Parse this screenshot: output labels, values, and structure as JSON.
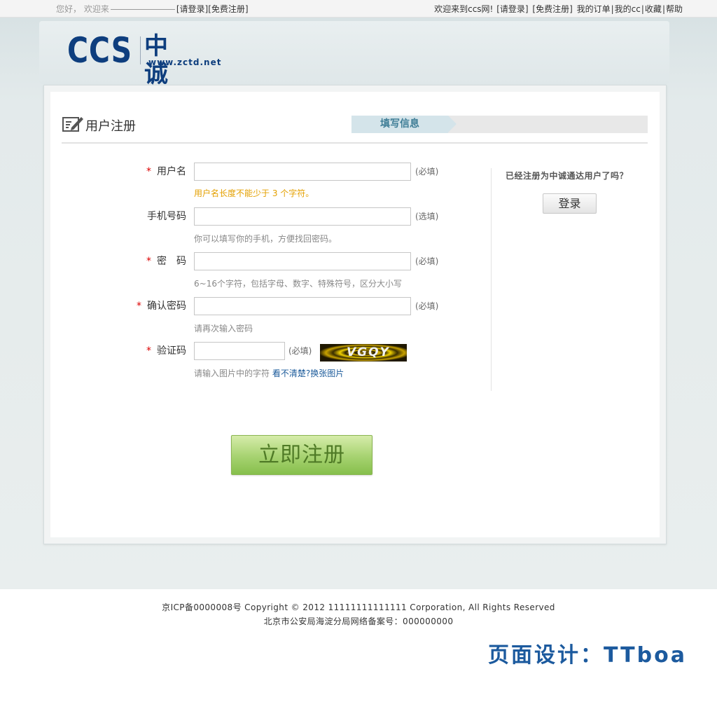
{
  "topbar": {
    "greeting": "您好，",
    "welcome": "欢迎来",
    "login_link": "[请登录]",
    "register_link": "[免费注册]",
    "site_welcome": "欢迎来到ccs网!",
    "right_login": "[请登录]",
    "right_register": "[免费注册]",
    "my_orders": "我的订单",
    "my_cc": "我的cc",
    "favorites": "收藏",
    "help": "帮助",
    "separator": "|"
  },
  "logo": {
    "abbr": "CCS",
    "name": "中诚通达",
    "url": "www.zctd.net"
  },
  "page": {
    "title": "用户注册",
    "step_active": "填写信息"
  },
  "form": {
    "username": {
      "label": "用户名",
      "required": "*",
      "tag": "(必填)",
      "hint": "用户名长度不能少于 3 个字符。",
      "value": ""
    },
    "phone": {
      "label": "手机号码",
      "tag": "(选填)",
      "hint": "你可以填写你的手机，方便找回密码。",
      "value": ""
    },
    "password": {
      "label": "密　码",
      "required": "*",
      "tag": "(必填)",
      "hint": "6~16个字符，包括字母、数字、特殊符号，区分大小写",
      "value": ""
    },
    "confirm": {
      "label": "确认密码",
      "required": "*",
      "tag": "(必填)",
      "hint": "请再次输入密码",
      "value": ""
    },
    "captcha": {
      "label": "验证码",
      "required": "*",
      "tag": "(必填)",
      "hint": "请输入图片中的字符",
      "unclear": "看不清楚?",
      "refresh": "换张图片",
      "image_text": "VGQY",
      "value": ""
    },
    "submit_label": "立即注册"
  },
  "sidebar": {
    "question": "已经注册为中诚通达用户了吗？",
    "login_label": "登录"
  },
  "footer": {
    "copyright": "京ICP备0000008号 Copyright © 2012 11111111111111 Corporation, All Rights Reserved",
    "record": "北京市公安局海淀分局网络备案号：000000000",
    "designer": "页面设计：TTboa"
  },
  "colors": {
    "brand": "#0e3e7e",
    "required": "#dd0000",
    "warn_hint": "#e4a000",
    "link": "#1a5a9a",
    "submit": "#a6d270"
  }
}
